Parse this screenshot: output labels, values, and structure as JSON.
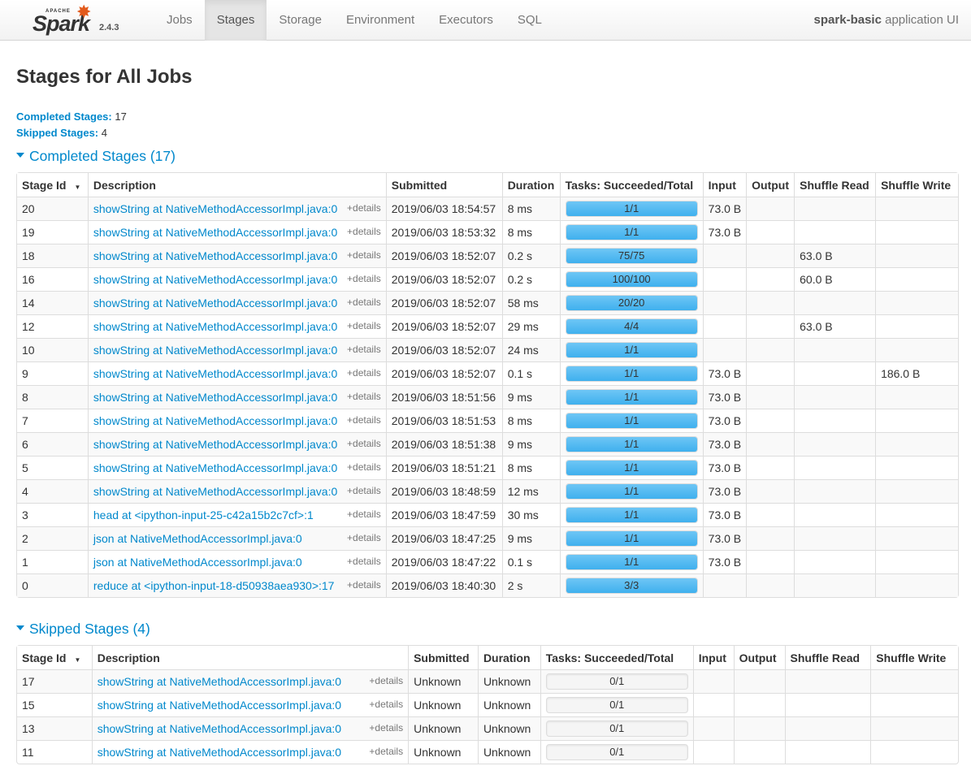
{
  "nav": {
    "apache": "APACHE",
    "spark": "Spark",
    "version": "2.4.3",
    "tabs": [
      {
        "label": "Jobs"
      },
      {
        "label": "Stages"
      },
      {
        "label": "Storage"
      },
      {
        "label": "Environment"
      },
      {
        "label": "Executors"
      },
      {
        "label": "SQL"
      }
    ],
    "active_tab": "Stages",
    "app_name": "spark-basic",
    "app_suffix": " application UI"
  },
  "page": {
    "title": "Stages for All Jobs",
    "completed_label": "Completed Stages:",
    "completed_count": "17",
    "skipped_label": "Skipped Stages:",
    "skipped_count": "4"
  },
  "completed": {
    "heading": "Completed Stages (17)",
    "headers": [
      "Stage Id",
      "Description",
      "Submitted",
      "Duration",
      "Tasks: Succeeded/Total",
      "Input",
      "Output",
      "Shuffle Read",
      "Shuffle Write"
    ],
    "details_label": "+details",
    "rows": [
      {
        "id": "20",
        "desc": "showString at NativeMethodAccessorImpl.java:0",
        "submitted": "2019/06/03 18:54:57",
        "duration": "8 ms",
        "tasks": "1/1",
        "progress": 1,
        "input": "73.0 B",
        "output": "",
        "shuffle_read": "",
        "shuffle_write": ""
      },
      {
        "id": "19",
        "desc": "showString at NativeMethodAccessorImpl.java:0",
        "submitted": "2019/06/03 18:53:32",
        "duration": "8 ms",
        "tasks": "1/1",
        "progress": 1,
        "input": "73.0 B",
        "output": "",
        "shuffle_read": "",
        "shuffle_write": ""
      },
      {
        "id": "18",
        "desc": "showString at NativeMethodAccessorImpl.java:0",
        "submitted": "2019/06/03 18:52:07",
        "duration": "0.2 s",
        "tasks": "75/75",
        "progress": 1,
        "input": "",
        "output": "",
        "shuffle_read": "63.0 B",
        "shuffle_write": ""
      },
      {
        "id": "16",
        "desc": "showString at NativeMethodAccessorImpl.java:0",
        "submitted": "2019/06/03 18:52:07",
        "duration": "0.2 s",
        "tasks": "100/100",
        "progress": 1,
        "input": "",
        "output": "",
        "shuffle_read": "60.0 B",
        "shuffle_write": ""
      },
      {
        "id": "14",
        "desc": "showString at NativeMethodAccessorImpl.java:0",
        "submitted": "2019/06/03 18:52:07",
        "duration": "58 ms",
        "tasks": "20/20",
        "progress": 1,
        "input": "",
        "output": "",
        "shuffle_read": "",
        "shuffle_write": ""
      },
      {
        "id": "12",
        "desc": "showString at NativeMethodAccessorImpl.java:0",
        "submitted": "2019/06/03 18:52:07",
        "duration": "29 ms",
        "tasks": "4/4",
        "progress": 1,
        "input": "",
        "output": "",
        "shuffle_read": "63.0 B",
        "shuffle_write": ""
      },
      {
        "id": "10",
        "desc": "showString at NativeMethodAccessorImpl.java:0",
        "submitted": "2019/06/03 18:52:07",
        "duration": "24 ms",
        "tasks": "1/1",
        "progress": 1,
        "input": "",
        "output": "",
        "shuffle_read": "",
        "shuffle_write": ""
      },
      {
        "id": "9",
        "desc": "showString at NativeMethodAccessorImpl.java:0",
        "submitted": "2019/06/03 18:52:07",
        "duration": "0.1 s",
        "tasks": "1/1",
        "progress": 1,
        "input": "73.0 B",
        "output": "",
        "shuffle_read": "",
        "shuffle_write": "186.0 B"
      },
      {
        "id": "8",
        "desc": "showString at NativeMethodAccessorImpl.java:0",
        "submitted": "2019/06/03 18:51:56",
        "duration": "9 ms",
        "tasks": "1/1",
        "progress": 1,
        "input": "73.0 B",
        "output": "",
        "shuffle_read": "",
        "shuffle_write": ""
      },
      {
        "id": "7",
        "desc": "showString at NativeMethodAccessorImpl.java:0",
        "submitted": "2019/06/03 18:51:53",
        "duration": "8 ms",
        "tasks": "1/1",
        "progress": 1,
        "input": "73.0 B",
        "output": "",
        "shuffle_read": "",
        "shuffle_write": ""
      },
      {
        "id": "6",
        "desc": "showString at NativeMethodAccessorImpl.java:0",
        "submitted": "2019/06/03 18:51:38",
        "duration": "9 ms",
        "tasks": "1/1",
        "progress": 1,
        "input": "73.0 B",
        "output": "",
        "shuffle_read": "",
        "shuffle_write": ""
      },
      {
        "id": "5",
        "desc": "showString at NativeMethodAccessorImpl.java:0",
        "submitted": "2019/06/03 18:51:21",
        "duration": "8 ms",
        "tasks": "1/1",
        "progress": 1,
        "input": "73.0 B",
        "output": "",
        "shuffle_read": "",
        "shuffle_write": ""
      },
      {
        "id": "4",
        "desc": "showString at NativeMethodAccessorImpl.java:0",
        "submitted": "2019/06/03 18:48:59",
        "duration": "12 ms",
        "tasks": "1/1",
        "progress": 1,
        "input": "73.0 B",
        "output": "",
        "shuffle_read": "",
        "shuffle_write": ""
      },
      {
        "id": "3",
        "desc": "head at <ipython-input-25-c42a15b2c7cf>:1",
        "submitted": "2019/06/03 18:47:59",
        "duration": "30 ms",
        "tasks": "1/1",
        "progress": 1,
        "input": "73.0 B",
        "output": "",
        "shuffle_read": "",
        "shuffle_write": ""
      },
      {
        "id": "2",
        "desc": "json at NativeMethodAccessorImpl.java:0",
        "submitted": "2019/06/03 18:47:25",
        "duration": "9 ms",
        "tasks": "1/1",
        "progress": 1,
        "input": "73.0 B",
        "output": "",
        "shuffle_read": "",
        "shuffle_write": ""
      },
      {
        "id": "1",
        "desc": "json at NativeMethodAccessorImpl.java:0",
        "submitted": "2019/06/03 18:47:22",
        "duration": "0.1 s",
        "tasks": "1/1",
        "progress": 1,
        "input": "73.0 B",
        "output": "",
        "shuffle_read": "",
        "shuffle_write": ""
      },
      {
        "id": "0",
        "desc": "reduce at <ipython-input-18-d50938aea930>:17",
        "submitted": "2019/06/03 18:40:30",
        "duration": "2 s",
        "tasks": "3/3",
        "progress": 1,
        "input": "",
        "output": "",
        "shuffle_read": "",
        "shuffle_write": ""
      }
    ]
  },
  "skipped": {
    "heading": "Skipped Stages (4)",
    "headers": [
      "Stage Id",
      "Description",
      "Submitted",
      "Duration",
      "Tasks: Succeeded/Total",
      "Input",
      "Output",
      "Shuffle Read",
      "Shuffle Write"
    ],
    "details_label": "+details",
    "rows": [
      {
        "id": "17",
        "desc": "showString at NativeMethodAccessorImpl.java:0",
        "submitted": "Unknown",
        "duration": "Unknown",
        "tasks": "0/1",
        "progress": 0,
        "input": "",
        "output": "",
        "shuffle_read": "",
        "shuffle_write": ""
      },
      {
        "id": "15",
        "desc": "showString at NativeMethodAccessorImpl.java:0",
        "submitted": "Unknown",
        "duration": "Unknown",
        "tasks": "0/1",
        "progress": 0,
        "input": "",
        "output": "",
        "shuffle_read": "",
        "shuffle_write": ""
      },
      {
        "id": "13",
        "desc": "showString at NativeMethodAccessorImpl.java:0",
        "submitted": "Unknown",
        "duration": "Unknown",
        "tasks": "0/1",
        "progress": 0,
        "input": "",
        "output": "",
        "shuffle_read": "",
        "shuffle_write": ""
      },
      {
        "id": "11",
        "desc": "showString at NativeMethodAccessorImpl.java:0",
        "submitted": "Unknown",
        "duration": "Unknown",
        "tasks": "0/1",
        "progress": 0,
        "input": "",
        "output": "",
        "shuffle_read": "",
        "shuffle_write": ""
      }
    ]
  },
  "colors": {
    "link": "#0088cc",
    "progress_fill": "#3fb0ee",
    "spark_orange": "#e25a1c"
  }
}
